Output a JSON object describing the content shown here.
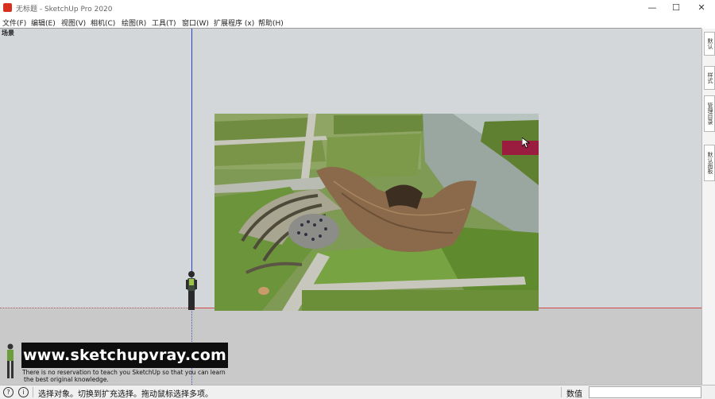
{
  "window": {
    "title": "无标题 - SketchUp Pro 2020",
    "minimize_glyph": "—",
    "maximize_glyph": "☐",
    "close_glyph": "✕",
    "app_icon": "sketchup-logo-icon"
  },
  "menu": [
    {
      "label": "文件(F)"
    },
    {
      "label": "编辑(E)"
    },
    {
      "label": "视图(V)"
    },
    {
      "label": "相机(C)"
    },
    {
      "label": "绘图(R)"
    },
    {
      "label": "工具(T)"
    },
    {
      "label": "窗口(W)"
    },
    {
      "label": "扩展程序 (x)"
    },
    {
      "label": "帮助(H)"
    }
  ],
  "viewport": {
    "scene_label": "场景",
    "colors": {
      "sky": "#d4d7da",
      "ground": "#c9c9c9",
      "blue_axis": "#2b3fc9",
      "red_axis": "#d04a4a"
    }
  },
  "right_panel": {
    "tabs": [
      {
        "label": "默认"
      },
      {
        "label": "样式"
      },
      {
        "label": "管理目录"
      },
      {
        "label": "默认面板"
      }
    ]
  },
  "watermark": {
    "url": "www.sketchupvray.com",
    "line1": "There is no reservation to teach you SketchUp so that you can learn",
    "line2": "the best original knowledge."
  },
  "statusbar": {
    "hint": "选择对象。切换到扩充选择。拖动鼠标选择多项。",
    "measure_label": "数值",
    "measure_value": "",
    "icons": [
      "help-circle-icon",
      "info-icon"
    ]
  }
}
